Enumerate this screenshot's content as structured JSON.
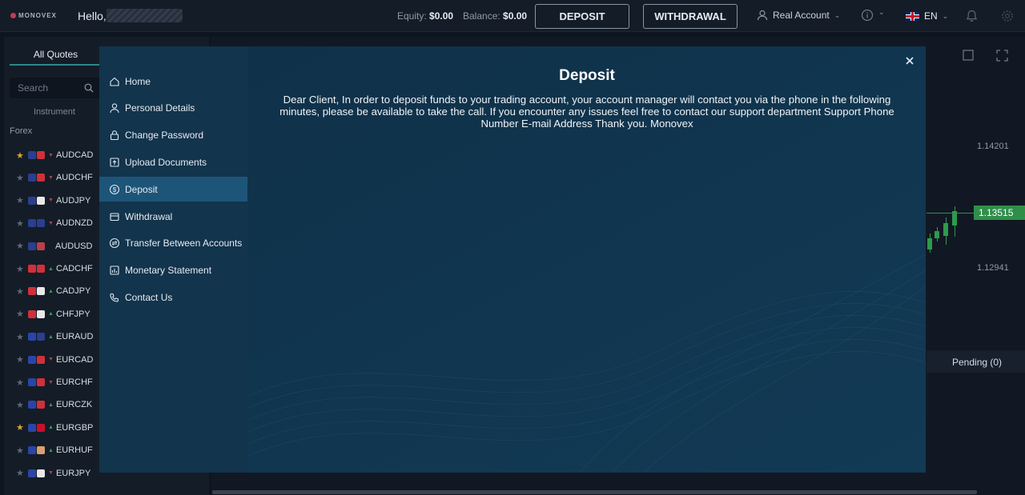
{
  "header": {
    "logo_text": "MONOVEX",
    "greeting": "Hello,",
    "equity_label": "Equity:",
    "equity_value": "$0.00",
    "balance_label": "Balance:",
    "balance_value": "$0.00",
    "deposit_button": "DEPOSIT",
    "withdrawal_button": "WITHDRAWAL",
    "account_label": "Real Account",
    "language": "EN"
  },
  "left_panel": {
    "tab_label": "All Quotes",
    "search_placeholder": "Search",
    "column_header": "Instrument",
    "group_label": "Forex",
    "quotes": [
      {
        "symbol": "AUDCAD",
        "favorite": true,
        "direction": "down",
        "flag1": "#2a3f8f",
        "flag2": "#d0303a"
      },
      {
        "symbol": "AUDCHF",
        "favorite": false,
        "direction": "down",
        "flag1": "#2a3f8f",
        "flag2": "#d0303a"
      },
      {
        "symbol": "AUDJPY",
        "favorite": false,
        "direction": "down",
        "flag1": "#2a3f8f",
        "flag2": "#e8e8e8"
      },
      {
        "symbol": "AUDNZD",
        "favorite": false,
        "direction": "down",
        "flag1": "#2a3f8f",
        "flag2": "#2a3f8f"
      },
      {
        "symbol": "AUDUSD",
        "favorite": false,
        "direction": "none",
        "flag1": "#2a3f8f",
        "flag2": "#b8404a"
      },
      {
        "symbol": "CADCHF",
        "favorite": false,
        "direction": "up",
        "flag1": "#d0303a",
        "flag2": "#d0303a"
      },
      {
        "symbol": "CADJPY",
        "favorite": false,
        "direction": "up",
        "flag1": "#d0303a",
        "flag2": "#e8e8e8"
      },
      {
        "symbol": "CHFJPY",
        "favorite": false,
        "direction": "up",
        "flag1": "#d0303a",
        "flag2": "#e8e8e8"
      },
      {
        "symbol": "EURAUD",
        "favorite": false,
        "direction": "up",
        "flag1": "#2a45a8",
        "flag2": "#2a3f8f"
      },
      {
        "symbol": "EURCAD",
        "favorite": false,
        "direction": "down",
        "flag1": "#2a45a8",
        "flag2": "#d0303a"
      },
      {
        "symbol": "EURCHF",
        "favorite": false,
        "direction": "down",
        "flag1": "#2a45a8",
        "flag2": "#d0303a"
      },
      {
        "symbol": "EURCZK",
        "favorite": false,
        "direction": "up",
        "flag1": "#2a45a8",
        "flag2": "#d0303a"
      },
      {
        "symbol": "EURGBP",
        "favorite": true,
        "direction": "up",
        "flag1": "#2a45a8",
        "flag2": "#c8102e"
      },
      {
        "symbol": "EURHUF",
        "favorite": false,
        "direction": "up",
        "flag1": "#2a45a8",
        "flag2": "#d8a070"
      },
      {
        "symbol": "EURJPY",
        "favorite": false,
        "direction": "down",
        "flag1": "#2a45a8",
        "flag2": "#e8e8e8"
      }
    ]
  },
  "chart": {
    "price_high": "1.14201",
    "price_current": "1.13515",
    "price_low": "1.12941",
    "pending_tab": "Pending (0)"
  },
  "modal": {
    "title": "Deposit",
    "message": "Dear Client, In order to deposit funds to your trading account, your account manager will contact you via the phone in the following minutes, please be available to take the call. If you encounter any issues feel free to contact our support department Support Phone Number E-mail Address Thank you. Monovex",
    "menu": [
      {
        "label": "Home",
        "icon": "home-icon"
      },
      {
        "label": "Personal Details",
        "icon": "user-icon"
      },
      {
        "label": "Change Password",
        "icon": "lock-icon"
      },
      {
        "label": "Upload Documents",
        "icon": "upload-icon"
      },
      {
        "label": "Deposit",
        "icon": "dollar-icon",
        "active": true
      },
      {
        "label": "Withdrawal",
        "icon": "wallet-icon"
      },
      {
        "label": "Transfer Between Accounts",
        "icon": "transfer-icon"
      },
      {
        "label": "Monetary Statement",
        "icon": "statement-icon"
      },
      {
        "label": "Contact Us",
        "icon": "phone-icon"
      }
    ]
  }
}
